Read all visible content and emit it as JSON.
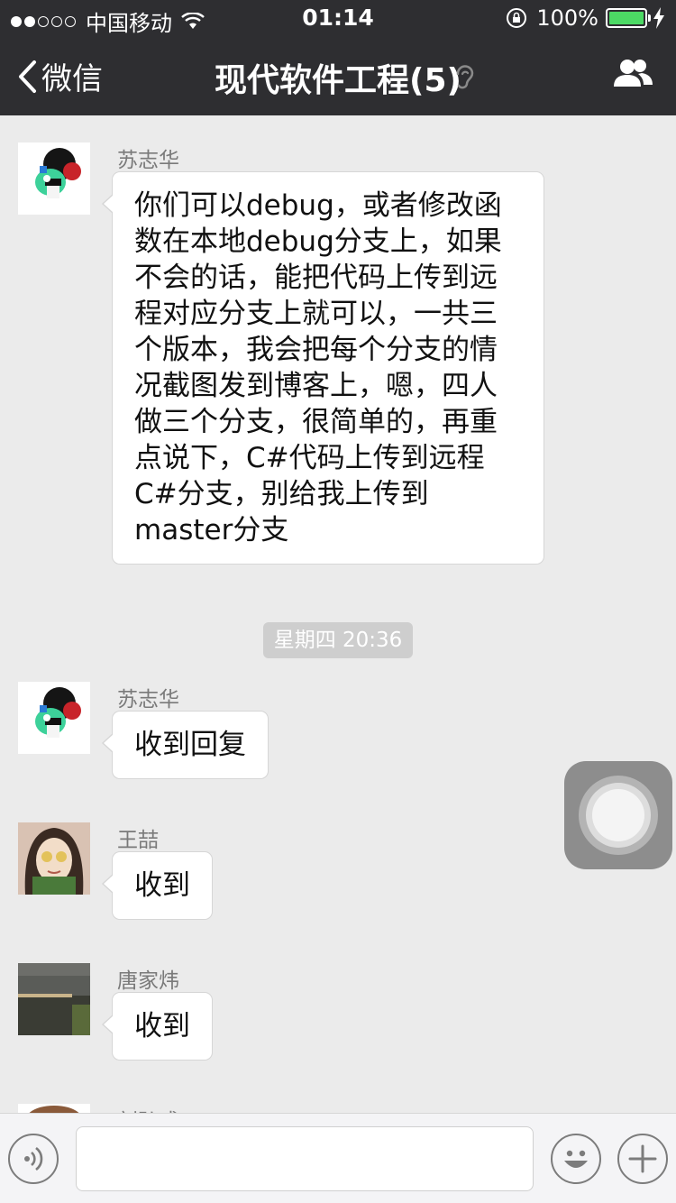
{
  "status_bar": {
    "carrier": "中国移动",
    "time": "01:14",
    "battery": "100%",
    "battery_level": 1.0
  },
  "header": {
    "back_label": "微信",
    "title": "现代软件工程(5)"
  },
  "messages": [
    {
      "sender": "苏志华",
      "text": "你们可以debug，或者修改函数在本地debug分支上，如果不会的话，能把代码上传到远程对应分支上就可以，一共三个版本，我会把每个分支的情况截图发到博客上，嗯，四人做三个分支，很简单的，再重点说下，C#代码上传到远程C#分支，别给我上传到master分支"
    },
    {
      "sender": "苏志华",
      "text": "收到回复"
    },
    {
      "sender": "王喆",
      "text": "收到"
    },
    {
      "sender": "唐家炜",
      "text": "收到"
    },
    {
      "sender": "刘弘成"
    }
  ],
  "time_divider": "星期四 20:36",
  "input": {
    "value": ""
  },
  "colors": {
    "nav_bg": "#2e2e31",
    "chat_bg": "#ebebeb",
    "bubble_bg": "#ffffff",
    "battery_green": "#4cd964"
  },
  "icons": {
    "back": "chevron-left-icon",
    "ear": "ear-icon",
    "group": "group-members-icon",
    "voice": "voice-icon",
    "emoji": "emoji-icon",
    "plus": "plus-icon"
  }
}
